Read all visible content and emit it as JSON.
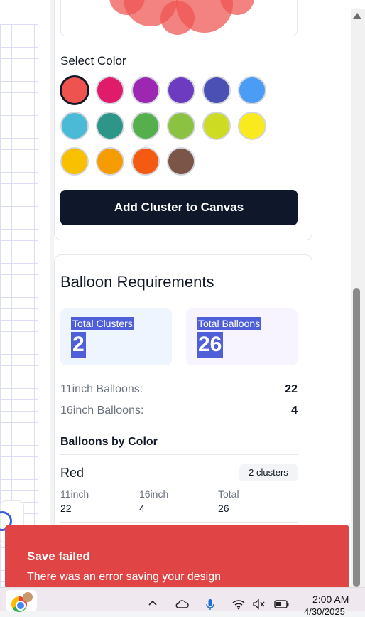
{
  "colors_section": {
    "label": "Select Color",
    "swatches": [
      {
        "name": "red",
        "hex": "#ef5350",
        "selected": true
      },
      {
        "name": "pink",
        "hex": "#e01b6a"
      },
      {
        "name": "purple",
        "hex": "#9c27b0"
      },
      {
        "name": "deep-purple",
        "hex": "#6d3bbf"
      },
      {
        "name": "indigo",
        "hex": "#4a50b4"
      },
      {
        "name": "blue",
        "hex": "#4b9cf5"
      },
      {
        "name": "cyan",
        "hex": "#4bbad6"
      },
      {
        "name": "teal",
        "hex": "#2e9688"
      },
      {
        "name": "green",
        "hex": "#55af4c"
      },
      {
        "name": "light-green",
        "hex": "#8bc241"
      },
      {
        "name": "lime",
        "hex": "#cddc22"
      },
      {
        "name": "yellow",
        "hex": "#f9ea1e"
      },
      {
        "name": "amber",
        "hex": "#f8c001"
      },
      {
        "name": "orange",
        "hex": "#f59c02"
      },
      {
        "name": "deep-orange",
        "hex": "#f55a12"
      },
      {
        "name": "brown",
        "hex": "#7a5548"
      }
    ],
    "add_button": "Add Cluster to Canvas"
  },
  "requirements": {
    "title": "Balloon Requirements",
    "total_clusters_label": "Total Clusters",
    "total_clusters": "2",
    "total_balloons_label": "Total Balloons",
    "total_balloons": "26",
    "rows": [
      {
        "label": "11inch Balloons:",
        "value": "22"
      },
      {
        "label": "16inch Balloons:",
        "value": "4"
      }
    ],
    "by_color_title": "Balloons by Color",
    "color_entry": {
      "name": "Red",
      "badge": "2 clusters",
      "col1_label": "11inch",
      "col1_value": "22",
      "col2_label": "16inch",
      "col2_value": "4",
      "col3_label": "Total",
      "col3_value": "26"
    }
  },
  "toast": {
    "title": "Save failed",
    "description": "There was an error saving your design"
  },
  "taskbar": {
    "time": "2:00 AM",
    "date": "4/30/2025"
  },
  "theme": {
    "preview_balloon_color": "#ef5350",
    "button_bg": "#0f172a",
    "toast_bg": "#e14444",
    "stat_highlight": "#4f5fd9"
  }
}
